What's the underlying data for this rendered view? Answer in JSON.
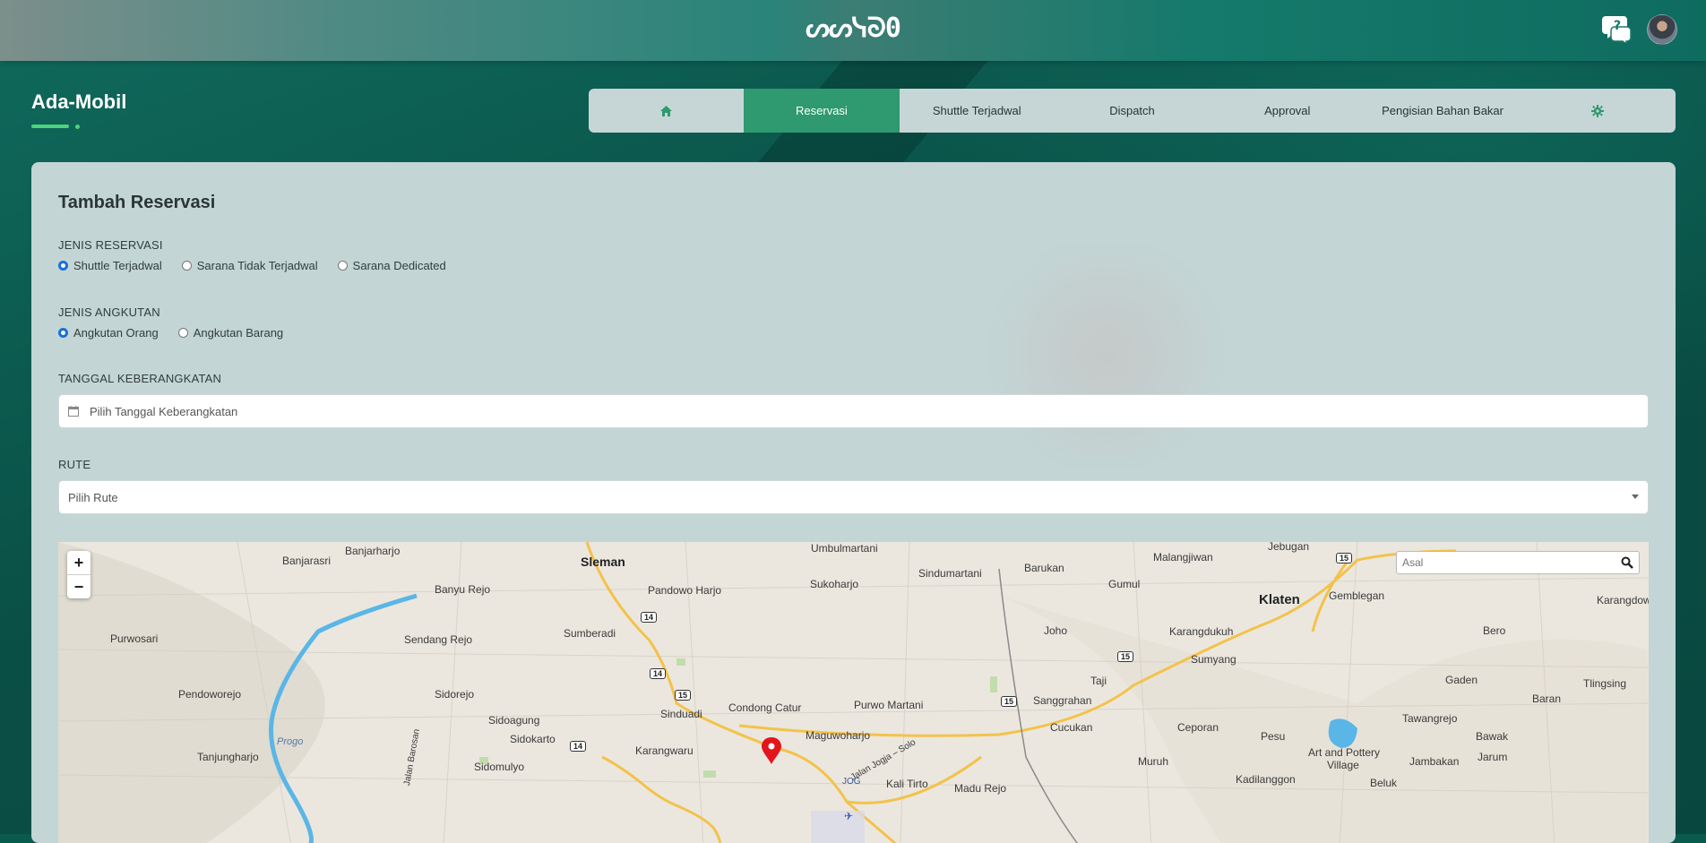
{
  "header": {
    "logo_text": "ᔕᔕᓭᘐ0"
  },
  "app": {
    "title": "Ada-Mobil"
  },
  "nav": {
    "items": [
      {
        "label": "",
        "icon": "home-icon"
      },
      {
        "label": "Reservasi"
      },
      {
        "label": "Shuttle Terjadwal"
      },
      {
        "label": "Dispatch"
      },
      {
        "label": "Approval"
      },
      {
        "label": "Pengisian Bahan Bakar"
      },
      {
        "label": "",
        "icon": "gear-icon"
      }
    ],
    "active_index": 1
  },
  "form": {
    "title": "Tambah Reservasi",
    "jenis_reservasi": {
      "label": "JENIS RESERVASI",
      "options": [
        "Shuttle Terjadwal",
        "Sarana Tidak Terjadwal",
        "Sarana Dedicated"
      ],
      "selected": "Shuttle Terjadwal"
    },
    "jenis_angkutan": {
      "label": "JENIS ANGKUTAN",
      "options": [
        "Angkutan Orang",
        "Angkutan Barang"
      ],
      "selected": "Angkutan Orang"
    },
    "tanggal": {
      "label": "TANGGAL KEBERANGKATAN",
      "placeholder": "Pilih Tanggal Keberangkatan",
      "value": ""
    },
    "rute": {
      "label": "RUTE",
      "placeholder": "Pilih Rute"
    }
  },
  "map": {
    "search_placeholder": "Asal",
    "zoom_in": "+",
    "zoom_out": "−",
    "places": {
      "banjarasri": "Banjarasri",
      "banjarharjo": "Banjarharjo",
      "banyu_rejo": "Banyu Rejo",
      "sleman": "Sleman",
      "umbulmartani": "Umbulmartani",
      "pandowo_harjo": "Pandowo Harjo",
      "sukoharjo": "Sukoharjo",
      "sindumartani": "Sindumartani",
      "barukan": "Barukan",
      "malangjiwan": "Malangjiwan",
      "jebugan": "Jebugan",
      "gumul": "Gumul",
      "klaten": "Klaten",
      "gemblegan": "Gemblegan",
      "karangdowo": "Karangdow",
      "purwosari": "Purwosari",
      "sendang_rejo": "Sendang Rejo",
      "sumberadi": "Sumberadi",
      "joho": "Joho",
      "karangdukuh": "Karangdukuh",
      "bero": "Bero",
      "sumyang": "Sumyang",
      "pendoworejo": "Pendoworejo",
      "sidorejo": "Sidorejo",
      "condong_catur": "Condong Catur",
      "purwo_martani": "Purwo Martani",
      "sanggrahan": "Sanggrahan",
      "taji": "Taji",
      "gaden": "Gaden",
      "tlingsing": "Tlingsing",
      "baran": "Baran",
      "sinduadi": "Sinduadi",
      "sidoagung": "Sidoagung",
      "sidokarto": "Sidokarto",
      "maguwoharjo": "Maguwoharjo",
      "cucukan": "Cucukan",
      "ceporan": "Ceporan",
      "pesu": "Pesu",
      "tawangrejo": "Tawangrejo",
      "bawak": "Bawak",
      "tanjungharjo": "Tanjungharjo",
      "progo": "Progo",
      "jalan_barosan": "Jalan Barosan",
      "karangwaru": "Karangwaru",
      "sidomulyo": "Sidomulyo",
      "jalan_jogja_solo": "Jalan Jogja – Solo",
      "art_pottery": "Art and Pottery",
      "village": "Village",
      "jambakan": "Jambakan",
      "jarum": "Jarum",
      "muruh": "Muruh",
      "kadilanggon": "Kadilanggon",
      "jog": "JOG",
      "kali_tirto": "Kali Tirto",
      "madu_rejo": "Madu Rejo",
      "beluk": "Beluk"
    },
    "road_shields": [
      "14",
      "14",
      "15",
      "14",
      "15",
      "15",
      "15"
    ]
  },
  "colors": {
    "accent": "#2f9a6f",
    "nav_bg": "#c6d6d6",
    "card_bg": "#c3d5d5",
    "radio_checked": "#1a6fd6",
    "marker": "#e3161b",
    "water": "#5ab6e6",
    "road": "#f3c24a"
  }
}
